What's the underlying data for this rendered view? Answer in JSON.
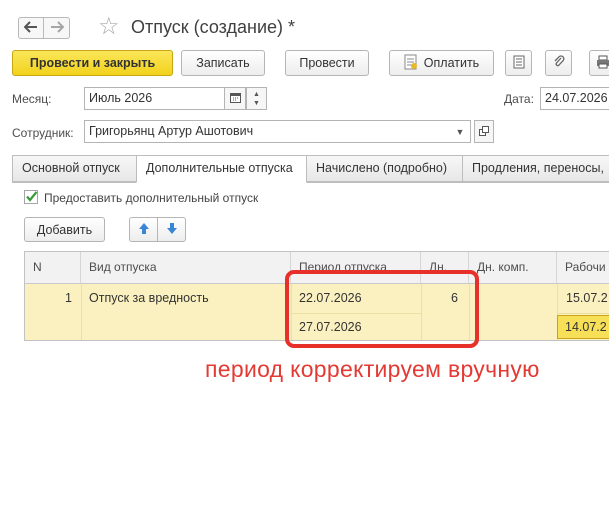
{
  "window": {
    "title": "Отпуск (создание) *",
    "back_icon": "arrow-left-icon",
    "forward_icon": "arrow-right-icon",
    "favorite_icon": "star-icon"
  },
  "toolbar": {
    "post_and_close": "Провести и закрыть",
    "save": "Записать",
    "post": "Провести",
    "pay": "Оплатить"
  },
  "form": {
    "month_label": "Месяц:",
    "month_value": "Июль 2026",
    "date_label": "Дата:",
    "date_value": "24.07.2026",
    "employee_label": "Сотрудник:",
    "employee_value": "Григорьянц Артур Ашотович"
  },
  "tabs": [
    {
      "label": "Основной отпуск"
    },
    {
      "label": "Дополнительные отпуска"
    },
    {
      "label": "Начислено (подробно)"
    },
    {
      "label": "Продления, переносы,"
    }
  ],
  "additional_leave": {
    "checkbox_label": "Предоставить дополнительный отпуск",
    "checked": true,
    "add_button": "Добавить"
  },
  "table": {
    "columns": [
      "N",
      "Вид отпуска",
      "Период отпуска",
      "Дн.",
      "Дн. комп.",
      "Рабочи"
    ],
    "rows": [
      {
        "n": "1",
        "type": "Отпуск за вредность",
        "period_start": "22.07.2026",
        "period_end": "27.07.2026",
        "days": "6",
        "comp_days": "",
        "work_start": "15.07.2",
        "work_end": "14.07.2"
      }
    ]
  },
  "annotation": "период корректируем вручную",
  "colors": {
    "primary_button": "#f5d923",
    "selected_row": "#fbf1c0",
    "highlight_box": "#e8302a",
    "check_green": "#3a9a3a",
    "arrow_blue": "#3a86d6"
  }
}
